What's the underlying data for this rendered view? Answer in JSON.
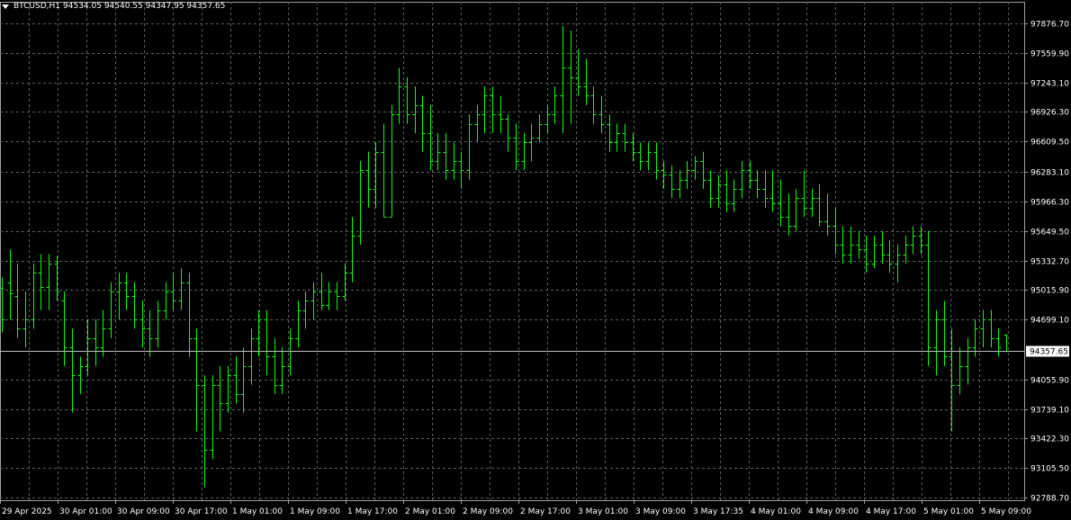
{
  "header": {
    "menu_icon": "triangle-down-icon",
    "symbol": "BTCUSD,H1",
    "ohlc": "94534.05 94540.55 94347.95 94357.65"
  },
  "colors": {
    "background": "#000000",
    "bars": "#00ff00",
    "grid": "#606060",
    "text": "#ffffff"
  },
  "current_price_label": "94357.65",
  "chart_data": {
    "type": "ohlc",
    "symbol": "BTCUSD",
    "timeframe": "H1",
    "grid": true,
    "ylim": [
      92788.7,
      97876.7
    ],
    "y_ticks": [
      "97876.70",
      "97559.90",
      "97243.10",
      "96926.30",
      "96609.50",
      "96283.10",
      "95966.30",
      "95649.50",
      "95332.70",
      "95015.90",
      "94699.10",
      "94357.65",
      "94055.90",
      "93739.10",
      "93422.30",
      "93105.50",
      "92788.70"
    ],
    "x_ticks": [
      "29 Apr 2025",
      "30 Apr 01:00",
      "30 Apr 09:00",
      "30 Apr 17:00",
      "1 May 01:00",
      "1 May 09:00",
      "1 May 17:00",
      "2 May 01:00",
      "2 May 09:00",
      "2 May 17:00",
      "3 May 01:00",
      "3 May 09:00",
      "3 May 17:35",
      "4 May 01:00",
      "4 May 09:00",
      "4 May 17:00",
      "5 May 01:00",
      "5 May 09:00"
    ],
    "current_price": 94357.65,
    "bars": [
      [
        95040,
        95150,
        94560,
        94700
      ],
      [
        95100,
        95450,
        94700,
        94980
      ],
      [
        94950,
        95300,
        94500,
        94600
      ],
      [
        94600,
        95000,
        94400,
        94700
      ],
      [
        94700,
        95300,
        94600,
        95200
      ],
      [
        95200,
        95400,
        94800,
        95050
      ],
      [
        95050,
        95400,
        94800,
        95300
      ],
      [
        95300,
        95380,
        94900,
        95000
      ],
      [
        94900,
        95000,
        94200,
        94400
      ],
      [
        94400,
        94600,
        93700,
        94100
      ],
      [
        94100,
        94300,
        93900,
        94200
      ],
      [
        94200,
        94700,
        94100,
        94500
      ],
      [
        94500,
        94700,
        94200,
        94400
      ],
      [
        94400,
        94800,
        94300,
        94600
      ],
      [
        94600,
        95100,
        94500,
        95000
      ],
      [
        95000,
        95200,
        94700,
        95100
      ],
      [
        95100,
        95200,
        94800,
        94950
      ],
      [
        94950,
        95100,
        94600,
        94700
      ],
      [
        94700,
        94900,
        94400,
        94600
      ],
      [
        94600,
        94800,
        94300,
        94500
      ],
      [
        94500,
        94900,
        94400,
        94800
      ],
      [
        94800,
        95100,
        94700,
        95000
      ],
      [
        95000,
        95200,
        94800,
        94900
      ],
      [
        94900,
        95250,
        94800,
        95100
      ],
      [
        95100,
        95200,
        94300,
        94500
      ],
      [
        94500,
        94600,
        93500,
        94000
      ],
      [
        94000,
        94100,
        92900,
        93300
      ],
      [
        93300,
        94100,
        93200,
        94000
      ],
      [
        94000,
        94200,
        93500,
        93800
      ],
      [
        93800,
        94200,
        93700,
        94100
      ],
      [
        94100,
        94300,
        93800,
        93900
      ],
      [
        93900,
        94400,
        93700,
        94200
      ],
      [
        94200,
        94600,
        94000,
        94500
      ],
      [
        94500,
        94800,
        94300,
        94700
      ],
      [
        94700,
        94800,
        94100,
        94300
      ],
      [
        94300,
        94500,
        93900,
        94000
      ],
      [
        94000,
        94400,
        93900,
        94200
      ],
      [
        94200,
        94600,
        94100,
        94500
      ],
      [
        94500,
        94900,
        94400,
        94800
      ],
      [
        94800,
        95000,
        94600,
        94900
      ],
      [
        94900,
        95100,
        94700,
        95000
      ],
      [
        95000,
        95200,
        94800,
        94850
      ],
      [
        94850,
        95100,
        94800,
        95000
      ],
      [
        95000,
        95100,
        94800,
        94950
      ],
      [
        94950,
        95300,
        94900,
        95200
      ],
      [
        95200,
        95800,
        95100,
        95600
      ],
      [
        95600,
        96400,
        95500,
        96300
      ],
      [
        96300,
        96500,
        95900,
        96100
      ],
      [
        96100,
        96600,
        95900,
        96500
      ],
      [
        96500,
        96800,
        95800,
        95800
      ],
      [
        95800,
        97000,
        95800,
        96900
      ],
      [
        96900,
        97400,
        96800,
        97200
      ],
      [
        97200,
        97300,
        96800,
        96900
      ],
      [
        96900,
        97200,
        96700,
        97000
      ],
      [
        97000,
        97100,
        96500,
        96700
      ],
      [
        96700,
        97000,
        96300,
        96400
      ],
      [
        96400,
        96700,
        96300,
        96500
      ],
      [
        96500,
        96700,
        96200,
        96300
      ],
      [
        96300,
        96600,
        96200,
        96400
      ],
      [
        96400,
        96500,
        96100,
        96300
      ],
      [
        96300,
        96900,
        96200,
        96800
      ],
      [
        96800,
        97000,
        96600,
        96900
      ],
      [
        96900,
        97200,
        96700,
        97100
      ],
      [
        97100,
        97200,
        96700,
        96900
      ],
      [
        96900,
        97100,
        96700,
        96850
      ],
      [
        96850,
        96900,
        96500,
        96650
      ],
      [
        96650,
        96800,
        96300,
        96400
      ],
      [
        96400,
        96700,
        96300,
        96600
      ],
      [
        96600,
        96800,
        96400,
        96650
      ],
      [
        96650,
        96900,
        96600,
        96800
      ],
      [
        96800,
        97000,
        96700,
        96900
      ],
      [
        96900,
        97200,
        96800,
        97100
      ],
      [
        97100,
        97850,
        96700,
        97400
      ],
      [
        97400,
        97800,
        96800,
        97300
      ],
      [
        97300,
        97600,
        97100,
        97200
      ],
      [
        97200,
        97500,
        97000,
        97100
      ],
      [
        97100,
        97200,
        96800,
        96900
      ],
      [
        96900,
        97100,
        96700,
        96800
      ],
      [
        96800,
        96900,
        96500,
        96600
      ],
      [
        96600,
        96800,
        96500,
        96700
      ],
      [
        96700,
        96800,
        96500,
        96600
      ],
      [
        96600,
        96700,
        96400,
        96500
      ],
      [
        96500,
        96600,
        96300,
        96400
      ],
      [
        96400,
        96600,
        96300,
        96500
      ],
      [
        96500,
        96600,
        96200,
        96300
      ],
      [
        96300,
        96400,
        96100,
        96250
      ],
      [
        96250,
        96350,
        96000,
        96100
      ],
      [
        96100,
        96300,
        96000,
        96200
      ],
      [
        96200,
        96400,
        96100,
        96300
      ],
      [
        96300,
        96450,
        96200,
        96400
      ],
      [
        96400,
        96500,
        96100,
        96200
      ],
      [
        96200,
        96300,
        95900,
        96000
      ],
      [
        96000,
        96250,
        95900,
        96150
      ],
      [
        96150,
        96300,
        95850,
        95950
      ],
      [
        95950,
        96200,
        95850,
        96100
      ],
      [
        96100,
        96400,
        96000,
        96300
      ],
      [
        96300,
        96400,
        96100,
        96200
      ],
      [
        96200,
        96300,
        96000,
        96100
      ],
      [
        96100,
        96300,
        95900,
        96000
      ],
      [
        96000,
        96300,
        95850,
        95950
      ],
      [
        95950,
        96200,
        95700,
        95800
      ],
      [
        95800,
        96050,
        95600,
        95700
      ],
      [
        95700,
        96100,
        95650,
        96000
      ],
      [
        96000,
        96300,
        95800,
        95900
      ],
      [
        95900,
        96100,
        95800,
        96000
      ],
      [
        96000,
        96150,
        95700,
        95750
      ],
      [
        95750,
        96050,
        95600,
        95700
      ],
      [
        95700,
        95900,
        95400,
        95500
      ],
      [
        95500,
        95700,
        95300,
        95400
      ],
      [
        95400,
        95700,
        95300,
        95500
      ],
      [
        95500,
        95650,
        95350,
        95450
      ],
      [
        95450,
        95600,
        95200,
        95300
      ],
      [
        95300,
        95600,
        95250,
        95500
      ],
      [
        95500,
        95650,
        95300,
        95400
      ],
      [
        95400,
        95550,
        95200,
        95300
      ],
      [
        95300,
        95500,
        95100,
        95400
      ],
      [
        95400,
        95600,
        95300,
        95500
      ],
      [
        95500,
        95700,
        95400,
        95600
      ],
      [
        95600,
        95700,
        95400,
        95500
      ],
      [
        95500,
        95650,
        94200,
        94400
      ],
      [
        94400,
        94800,
        94100,
        94700
      ],
      [
        94700,
        94900,
        94200,
        94300
      ],
      [
        94300,
        94600,
        93500,
        94000
      ],
      [
        94000,
        94400,
        93900,
        94200
      ],
      [
        94200,
        94500,
        94000,
        94400
      ],
      [
        94400,
        94700,
        94300,
        94600
      ],
      [
        94600,
        94800,
        94400,
        94700
      ],
      [
        94700,
        94800,
        94400,
        94500
      ],
      [
        94500,
        94600,
        94300,
        94400
      ],
      [
        94534.05,
        94540.55,
        94347.95,
        94357.65
      ]
    ]
  }
}
